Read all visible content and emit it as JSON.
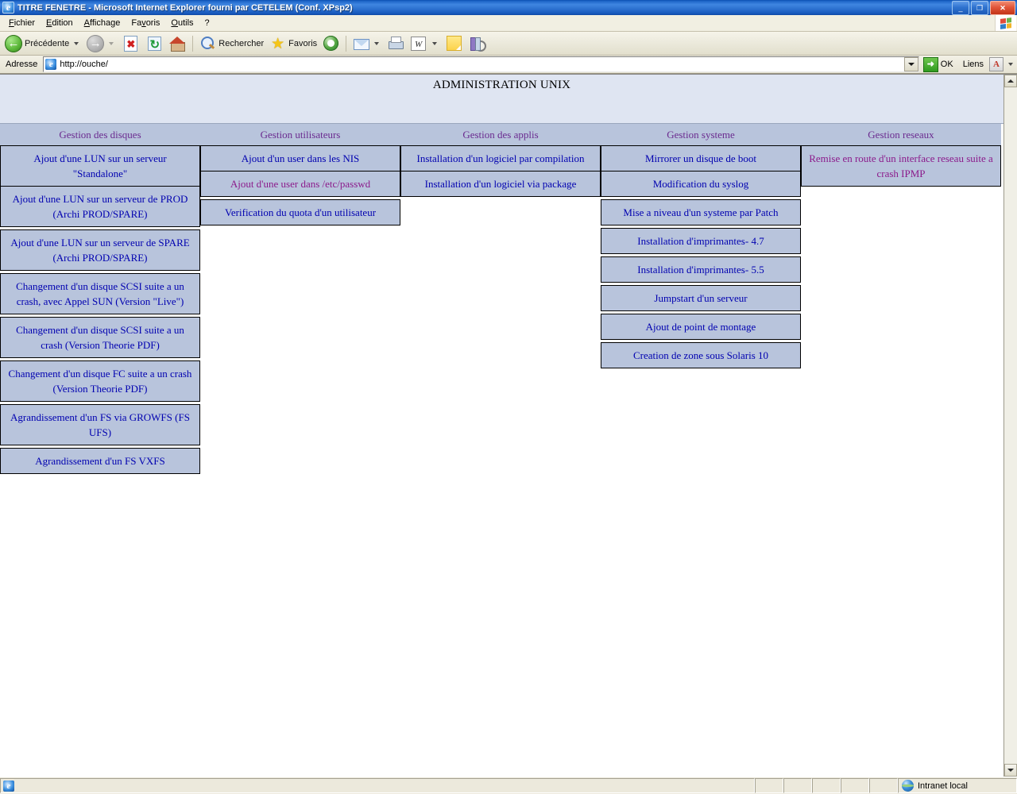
{
  "window": {
    "title": "TITRE FENETRE - Microsoft Internet Explorer fourni par CETELEM (Conf. XPsp2)",
    "minimize": "_",
    "maximize": "❐",
    "close": "✕"
  },
  "menubar": {
    "items": [
      {
        "label": "Fichier",
        "accel": "F"
      },
      {
        "label": "Edition",
        "accel": "E"
      },
      {
        "label": "Affichage",
        "accel": "A"
      },
      {
        "label": "Favoris",
        "accel": "v"
      },
      {
        "label": "Outils",
        "accel": "O"
      },
      {
        "label": "?",
        "accel": ""
      }
    ],
    "flag_icon": "windows-flag-icon"
  },
  "toolbar": {
    "back_label": "Précédente",
    "back_icon": "back-arrow-icon",
    "forward_icon": "forward-arrow-icon",
    "stop_icon": "stop-icon",
    "refresh_icon": "refresh-icon",
    "home_icon": "home-icon",
    "search_label": "Rechercher",
    "search_icon": "search-icon",
    "favorites_label": "Favoris",
    "favorites_icon": "star-icon",
    "media_icon": "media-icon",
    "mail_icon": "mail-icon",
    "print_icon": "printer-icon",
    "word_icon": "word-icon",
    "note_icon": "note-icon",
    "research_icon": "research-books-icon"
  },
  "address": {
    "label": "Adresse",
    "url": "http://ouche/",
    "placeholder": "http://",
    "site_icon": "ie-page-icon",
    "dropdown_icon": "chevron-down-icon",
    "go_label": "OK",
    "go_icon": "go-arrow-icon",
    "links_label": "Liens",
    "pdf_icon": "adobe-pdf-icon"
  },
  "page": {
    "banner_title": "ADMINISTRATION UNIX",
    "columns": [
      {
        "heading": "Gestion des disques",
        "groups": [
          {
            "items": [
              {
                "label": "Ajout d'une LUN sur un serveur \"Standalone\"",
                "state": "link"
              },
              {
                "label": "Ajout d'une LUN sur un serveur de PROD (Archi PROD/SPARE)",
                "state": "link"
              }
            ]
          },
          {
            "items": [
              {
                "label": "Ajout d'une LUN sur un serveur de SPARE (Archi PROD/SPARE)",
                "state": "link"
              }
            ]
          },
          {
            "items": [
              {
                "label": "Changement d'un disque SCSI suite a un crash, avec Appel SUN (Version \"Live\")",
                "state": "link"
              }
            ]
          },
          {
            "items": [
              {
                "label": "Changement d'un disque SCSI suite a un crash (Version Theorie PDF)",
                "state": "link"
              }
            ]
          },
          {
            "items": [
              {
                "label": "Changement d'un disque FC suite a un crash (Version Theorie PDF)",
                "state": "link"
              }
            ]
          },
          {
            "items": [
              {
                "label": "Agrandissement d'un FS via GROWFS (FS UFS)",
                "state": "link"
              }
            ]
          },
          {
            "items": [
              {
                "label": "Agrandissement d'un FS VXFS",
                "state": "link"
              }
            ]
          }
        ]
      },
      {
        "heading": "Gestion utilisateurs",
        "groups": [
          {
            "items": [
              {
                "label": "Ajout d'un user dans les NIS",
                "state": "link"
              },
              {
                "label": "Ajout d'une user dans /etc/passwd",
                "state": "visited"
              }
            ]
          },
          {
            "items": [
              {
                "label": "Verification du quota d'un utilisateur",
                "state": "link"
              }
            ]
          }
        ]
      },
      {
        "heading": "Gestion des applis",
        "groups": [
          {
            "items": [
              {
                "label": "Installation d'un logiciel par compilation",
                "state": "link"
              },
              {
                "label": "Installation d'un logiciel via package",
                "state": "link"
              }
            ]
          }
        ]
      },
      {
        "heading": "Gestion systeme",
        "groups": [
          {
            "items": [
              {
                "label": "Mirrorer un disque de boot",
                "state": "link"
              },
              {
                "label": "Modification du syslog",
                "state": "link"
              }
            ]
          },
          {
            "items": [
              {
                "label": "Mise a niveau d'un systeme par Patch",
                "state": "link"
              }
            ]
          },
          {
            "items": [
              {
                "label": "Installation d'imprimantes- 4.7",
                "state": "link"
              }
            ]
          },
          {
            "items": [
              {
                "label": "Installation d'imprimantes- 5.5",
                "state": "link"
              }
            ]
          },
          {
            "items": [
              {
                "label": "Jumpstart d'un serveur",
                "state": "link"
              }
            ]
          },
          {
            "items": [
              {
                "label": "Ajout de point de montage",
                "state": "link"
              }
            ]
          },
          {
            "items": [
              {
                "label": "Creation de zone sous Solaris 10",
                "state": "link"
              }
            ]
          }
        ]
      },
      {
        "heading": "Gestion reseaux",
        "groups": [
          {
            "items": [
              {
                "label": "Remise en route d'un interface reseau suite a crash IPMP",
                "state": "visited"
              }
            ]
          }
        ]
      }
    ]
  },
  "statusbar": {
    "message": "",
    "zone": "Intranet local",
    "zone_icon": "globe-icon",
    "page_icon": "ie-page-icon"
  },
  "colors": {
    "link": "#0000b0",
    "visited": "#8b1a8b",
    "heading": "#6a2a8f",
    "cell_bg": "#b8c4dc",
    "banner_bg": "#dfe5f2",
    "title_bar": "#1f66c9"
  }
}
